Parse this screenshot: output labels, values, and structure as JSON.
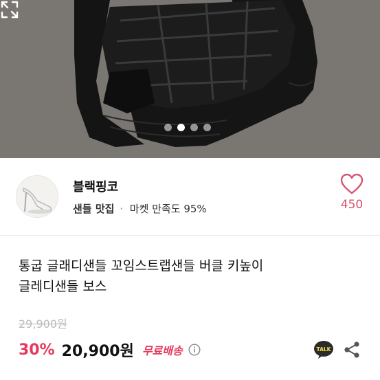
{
  "gallery": {
    "current_index": 2,
    "total": 4,
    "expand_icon": "expand-icon"
  },
  "seller": {
    "name": "블랙핑코",
    "tag": "샌들 맛집",
    "separator": "·",
    "rating_text": "마켓 만족도 95%",
    "like_count": "450",
    "like_icon": "heart-outline-icon",
    "accent": "#d9536f"
  },
  "product": {
    "title_line1": "통굽 글래디샌들 꼬임스트랩샌들 버클 키높이",
    "title_line2": "글레디샌들 보스",
    "original_price": "29,900원",
    "discount": "30%",
    "price": "20,900원",
    "shipping": "무료배송",
    "info_icon": "info-icon",
    "talk_label": "TALK",
    "talk_icon": "kakaotalk-icon",
    "share_icon": "share-icon",
    "discount_color": "#e8385d"
  }
}
